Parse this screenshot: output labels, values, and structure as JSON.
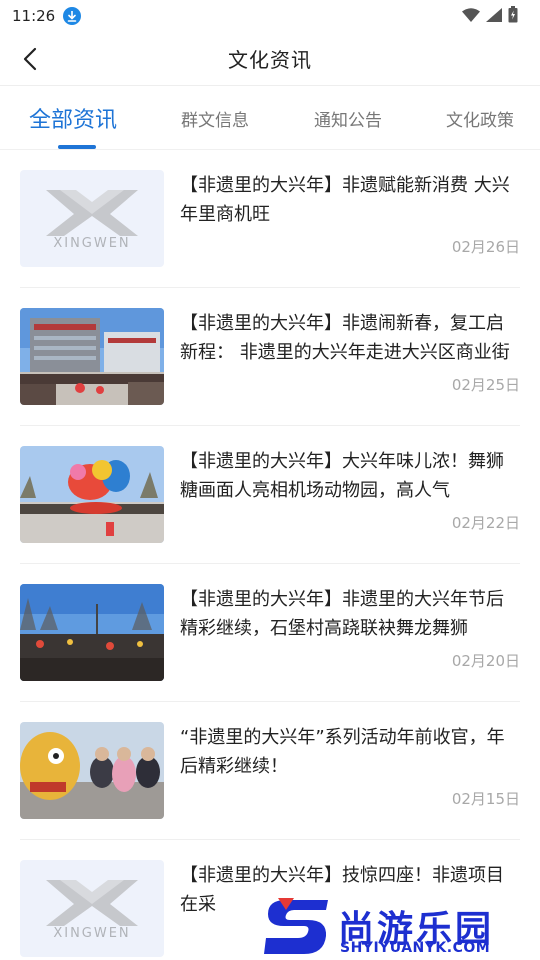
{
  "status_bar": {
    "time": "11:26"
  },
  "nav": {
    "title": "文化资讯"
  },
  "tabs": [
    {
      "label": "全部资讯"
    },
    {
      "label": "群文信息"
    },
    {
      "label": "通知公告"
    },
    {
      "label": "文化政策"
    }
  ],
  "placeholder_logo": {
    "text": "XINGWEN"
  },
  "articles": [
    {
      "title": "【非遗里的大兴年】非遗赋能新消费 大兴年里商机旺",
      "date": "02月26日"
    },
    {
      "title": "【非遗里的大兴年】非遗闹新春，复工启新程： 非遗里的大兴年走进大兴区商业街",
      "date": "02月25日"
    },
    {
      "title": "【非遗里的大兴年】大兴年味儿浓！舞狮糖画面人亮相机场动物园，高人气",
      "date": "02月22日"
    },
    {
      "title": "【非遗里的大兴年】非遗里的大兴年节后精彩继续，石堡村高跷联袂舞龙舞狮",
      "date": "02月20日"
    },
    {
      "title": "“非遗里的大兴年”系列活动年前收官，年后精彩继续！",
      "date": "02月15日"
    },
    {
      "title": "【非遗里的大兴年】技惊四座！非遗项目在采",
      "date": ""
    }
  ],
  "watermark": {
    "brand": "尚游乐园",
    "url": "SHYIYUANYK.COM"
  },
  "colors": {
    "accent": "#1e74d6",
    "watermark": "#1d2fd0",
    "date_gray": "#a8a8a8"
  }
}
